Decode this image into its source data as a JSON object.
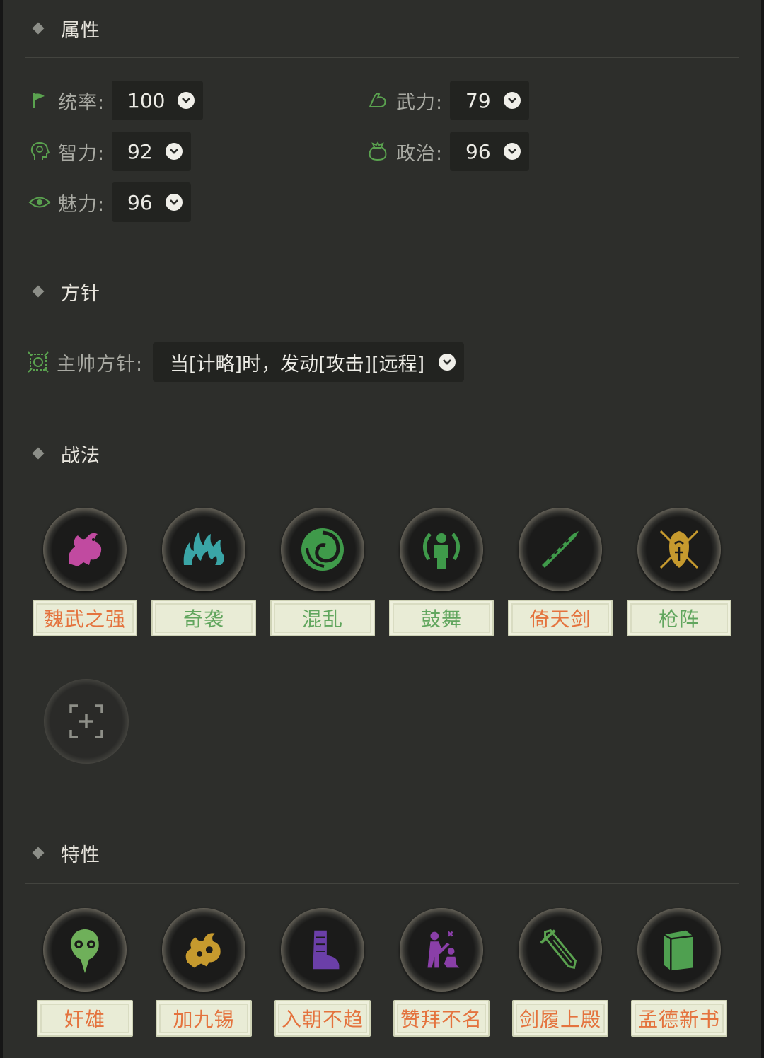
{
  "sections": {
    "attributes": "属性",
    "policy": "方针",
    "tactics": "战法",
    "traits": "特性"
  },
  "attributes": [
    {
      "label": "统率:",
      "value": "100",
      "icon": "flag-icon",
      "color": "#5aa24f"
    },
    {
      "label": "武力:",
      "value": "79",
      "icon": "muscle-arm-icon",
      "color": "#5aa24f"
    },
    {
      "label": "智力:",
      "value": "92",
      "icon": "brain-head-icon",
      "color": "#5aa24f"
    },
    {
      "label": "政治:",
      "value": "96",
      "icon": "money-bag-icon",
      "color": "#5aa24f"
    },
    {
      "label": "魅力:",
      "value": "96",
      "icon": "eye-icon",
      "color": "#5aa24f"
    }
  ],
  "policy": {
    "label": "主帅方针:",
    "value": "当[计略]时，发动[攻击][远程]",
    "icon": "commander-seal-icon"
  },
  "tactics": [
    {
      "name": "魏武之强",
      "icon": "qilin-beast-icon",
      "icon_color": "#c14aa0",
      "text_color": "#e4733e"
    },
    {
      "name": "奇袭",
      "icon": "flames-icon",
      "icon_color": "#3aa5a6",
      "text_color": "#61a65e"
    },
    {
      "name": "混乱",
      "icon": "swirl-icon",
      "icon_color": "#3f9a4a",
      "text_color": "#61a65e"
    },
    {
      "name": "鼓舞",
      "icon": "figure-aura-icon",
      "icon_color": "#3f9a4a",
      "text_color": "#61a65e"
    },
    {
      "name": "倚天剑",
      "icon": "rune-sword-icon",
      "icon_color": "#3f9a4a",
      "text_color": "#e4733e"
    },
    {
      "name": "枪阵",
      "icon": "shield-spears-icon",
      "icon_color": "#c69a2e",
      "text_color": "#61a65e"
    }
  ],
  "add_tactic": {
    "icon": "add-slot-icon"
  },
  "traits": [
    {
      "name": "奸雄",
      "icon": "plague-mask-icon",
      "icon_color": "#6fb05a",
      "text_color": "#e4733e"
    },
    {
      "name": "加九锡",
      "icon": "beast-emblem-icon",
      "icon_color": "#c69a2e",
      "text_color": "#e4733e"
    },
    {
      "name": "入朝不趋",
      "icon": "boot-icon",
      "icon_color": "#6b3fa8",
      "text_color": "#e4733e"
    },
    {
      "name": "赞拜不名",
      "icon": "kneeling-figures-icon",
      "icon_color": "#8a3fa8",
      "text_color": "#e4733e"
    },
    {
      "name": "剑履上殿",
      "icon": "sword-icon",
      "icon_color": "#5aa24f",
      "text_color": "#e4733e"
    },
    {
      "name": "孟德新书",
      "icon": "book-icon",
      "icon_color": "#4fa050",
      "text_color": "#e4733e"
    }
  ]
}
